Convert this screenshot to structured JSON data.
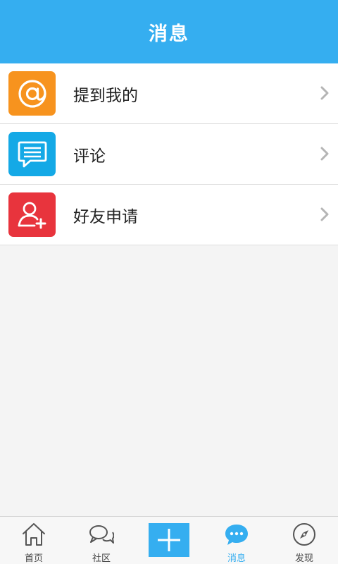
{
  "header": {
    "title": "消息"
  },
  "list": {
    "items": [
      {
        "label": "提到我的",
        "icon": "at-icon",
        "color": "#f7931e"
      },
      {
        "label": "评论",
        "icon": "comment-icon",
        "color": "#14a9e6"
      },
      {
        "label": "好友申请",
        "icon": "add-friend-icon",
        "color": "#e8343d"
      }
    ]
  },
  "tabbar": {
    "accent": "#35aef0",
    "tabs": [
      {
        "label": "首页",
        "icon": "home-icon",
        "active": false
      },
      {
        "label": "社区",
        "icon": "chat-bubbles-icon",
        "active": false
      },
      {
        "label": "",
        "icon": "plus-icon",
        "active": false
      },
      {
        "label": "消息",
        "icon": "message-bubble-icon",
        "active": true
      },
      {
        "label": "发现",
        "icon": "compass-icon",
        "active": false
      }
    ]
  }
}
